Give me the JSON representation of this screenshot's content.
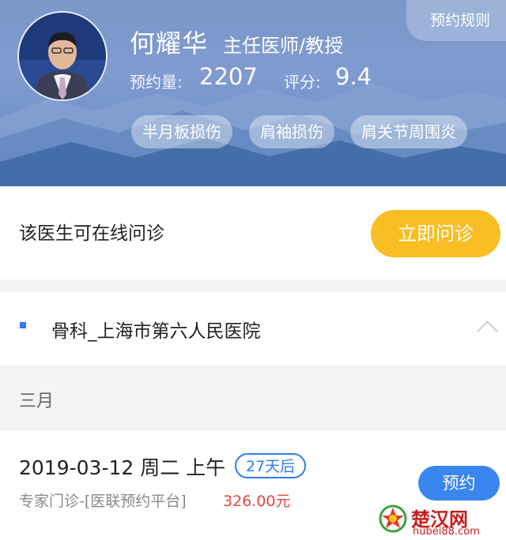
{
  "doctor": {
    "name": "何耀华",
    "title": "主任医师/教授",
    "appointments_label": "预约量:",
    "appointments_value": "2207",
    "rating_label": "评分:",
    "rating_value": "9.4",
    "tags": [
      "半月板损伤",
      "肩袖损伤",
      "肩关节周围炎"
    ]
  },
  "header": {
    "rules_label": "预约规则"
  },
  "consult": {
    "text": "该医生可在线问诊",
    "button_label": "立即问诊"
  },
  "department": {
    "name": "骨科_上海市第六人民医院"
  },
  "month_label": "三月",
  "slot": {
    "date": "2019-03-12 周二 上午",
    "badge": "27天后",
    "desc": "专家门诊-[医联预约平台]",
    "price": "326.00元",
    "book_label": "预约"
  },
  "watermark": {
    "name": "楚汉网",
    "domain": "hubei88.com"
  },
  "colors": {
    "accent_blue": "#2f7bf0",
    "consult_yellow": "#f9be23",
    "price_red": "#e8483a"
  }
}
